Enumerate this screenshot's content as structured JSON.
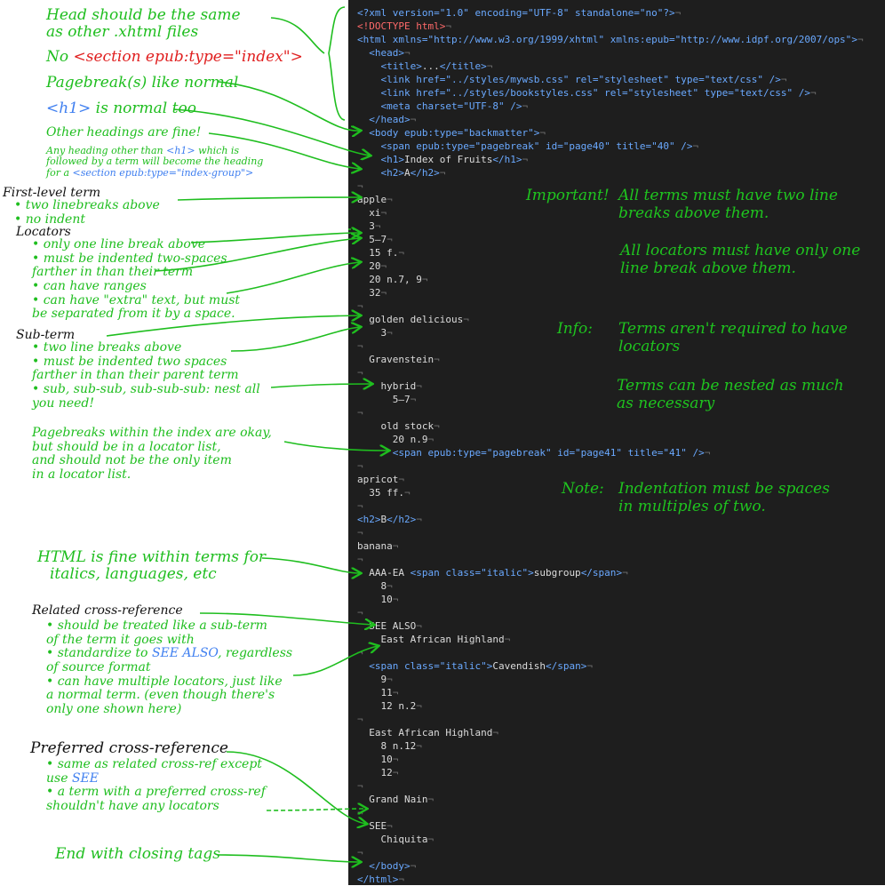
{
  "left_notes": {
    "head_same": [
      "Head should be the same",
      "as other .xhtml files"
    ],
    "no_section_prefix": "No",
    "no_section_code": "<section epub:type=\"index\">",
    "pagebreaks_normal": "Pagebreak(s) like normal",
    "h1_code": "<h1>",
    "h1_rest": " is normal too",
    "other_headings": "Other headings are fine!",
    "other_headings_detail_1a": "Any heading other than ",
    "other_headings_detail_1b": "<h1>",
    "other_headings_detail_1c": " which is",
    "other_headings_detail_2": "followed by a term will become the heading",
    "other_headings_detail_3a": "for a ",
    "other_headings_detail_3b": "<section epub:type=\"index-group\">",
    "first_level_term": "First-level term",
    "first_level_items": [
      "• two linebreaks above",
      "• no indent"
    ],
    "locators": "Locators",
    "locator_items": [
      "• only one line break above",
      "• must be indented two-spaces",
      "   farther in than their term",
      "• can have ranges",
      "• can have \"extra\" text, but must",
      "   be separated from it by a space."
    ],
    "sub_term": "Sub-term",
    "sub_term_items": [
      "• two line breaks above",
      "• must be indented two spaces",
      "   farther in than their parent term",
      "• sub, sub-sub, sub-sub-sub: nest all",
      "   you need!"
    ],
    "pagebreaks_index": [
      "Pagebreaks within the index are okay,",
      "but should be in a locator list,",
      "and should not be the only item",
      "in a locator list."
    ],
    "html_fine": [
      "HTML is fine within terms for",
      "italics, languages, etc"
    ],
    "related_xref": "Related cross-reference",
    "related_items_1": "• should be treated like a sub-term",
    "related_items_2": "   of the term it goes with",
    "related_items_3a": "• standardize to ",
    "related_items_3b": "SEE ALSO",
    "related_items_3c": ", regardless",
    "related_items_4": "   of source format",
    "related_items_5": "• can have multiple locators, just like",
    "related_items_6": "   a normal term. (even though there's",
    "related_items_7": "   only one shown here)",
    "preferred_xref": "Preferred cross-reference",
    "preferred_items_1": "• same as related cross-ref except",
    "preferred_items_2a": "   use ",
    "preferred_items_2b": "SEE",
    "preferred_items_3": "• a term with a preferred cross-ref",
    "preferred_items_4": "   shouldn't have any locators",
    "end_closing": "End with closing tags"
  },
  "code_notes": {
    "important_a": "Important!",
    "important_b": [
      "All terms must have two line",
      "breaks above them."
    ],
    "locators_rule": [
      "All locators must have only one",
      "line break above them."
    ],
    "info_a": "Info:",
    "info_b": [
      "Terms aren't required to have",
      "locators"
    ],
    "nested": [
      "Terms can be nested as much",
      "as necessary"
    ],
    "note_a": "Note:",
    "note_b": [
      "Indentation must be spaces",
      "in multiples of two."
    ]
  },
  "code_lines": [
    "<?xml version=\"1.0\" encoding=\"UTF-8\" standalone=\"no\"?>¬",
    "<!DOCTYPE html>¬",
    "<html xmlns=\"http://www.w3.org/1999/xhtml\" xmlns:epub=\"http://www.idpf.org/2007/ops\">¬",
    "  <head>¬",
    "    <title>...</title>¬",
    "    <link href=\"../styles/mywsb.css\" rel=\"stylesheet\" type=\"text/css\" />¬",
    "    <link href=\"../styles/bookstyles.css\" rel=\"stylesheet\" type=\"text/css\" />¬",
    "    <meta charset=\"UTF-8\" />¬",
    "  </head>¬",
    "  <body epub:type=\"backmatter\">¬",
    "    <span epub:type=\"pagebreak\" id=\"page40\" title=\"40\" />¬",
    "    <h1>Index of Fruits</h1>¬",
    "    <h2>A</h2>¬",
    "¬",
    "apple¬",
    "  xi¬",
    "  3¬",
    "  5–7¬",
    "  15 f.¬",
    "  20¬",
    "  20 n.7, 9¬",
    "  32¬",
    "¬",
    "  golden delicious¬",
    "    3¬",
    "¬",
    "  Gravenstein¬",
    "¬",
    "    hybrid¬",
    "      5–7¬",
    "¬",
    "    old stock¬",
    "      20 n.9¬",
    "      <span epub:type=\"pagebreak\" id=\"page41\" title=\"41\" />¬",
    "¬",
    "apricot¬",
    "  35 ff.¬",
    "¬",
    "<h2>B</h2>¬",
    "¬",
    "banana¬",
    "¬",
    "  AAA-EA <span class=\"italic\">subgroup</span>¬",
    "    8¬",
    "    10¬",
    "¬",
    "  SEE ALSO¬",
    "    East African Highland¬",
    "¬",
    "  <span class=\"italic\">Cavendish</span>¬",
    "    9¬",
    "    11¬",
    "    12 n.2¬",
    "¬",
    "  East African Highland¬",
    "    8 n.12¬",
    "    10¬",
    "    12¬",
    "¬",
    "  Grand Nain¬",
    "¬",
    "  SEE¬",
    "    Chiquita¬",
    "¬",
    "  </body>¬",
    "</html>¬"
  ]
}
